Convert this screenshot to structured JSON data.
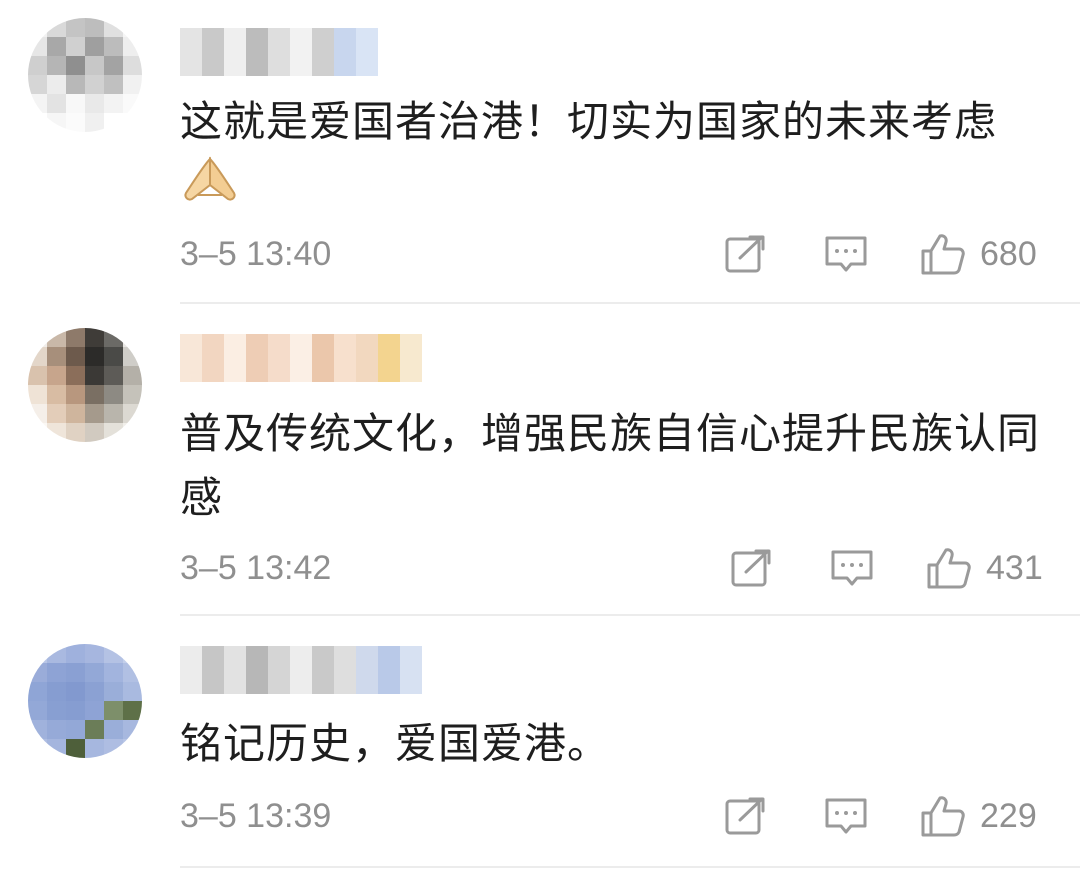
{
  "comments": [
    {
      "text": "这就是爱国者治港！切实为国家的未来考虑",
      "emoji": "folded-hands-emoji",
      "time": "3–5 13:40",
      "likes": "680"
    },
    {
      "text": "普及传统文化，增强民族自信心提升民族认同感",
      "time": "3–5 13:42",
      "likes": "431"
    },
    {
      "text": "铭记历史，爱国爱港。",
      "time": "3–5 13:39",
      "likes": "229"
    }
  ],
  "icons": {
    "share": "share-icon",
    "reply": "comment-icon",
    "like": "thumbs-up-icon"
  },
  "colors": {
    "meta_gray": "#8f8f8f",
    "icon_gray": "#9a9a9a",
    "divider": "#ececec"
  }
}
